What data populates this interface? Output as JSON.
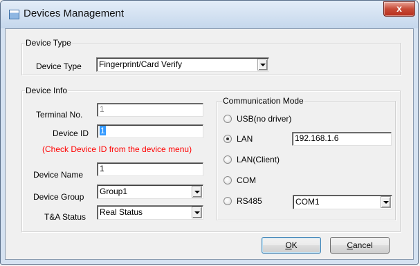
{
  "window": {
    "title": "Devices Management",
    "close_label": "x"
  },
  "device_type_group": {
    "legend": "Device Type",
    "label": "Device Type",
    "value": "Fingerprint/Card Verify"
  },
  "device_info_group": {
    "legend": "Device Info",
    "terminal_no_label": "Terminal No.",
    "terminal_no_value": "1",
    "device_id_label": "Device ID",
    "device_id_value": "1",
    "device_id_hint": "(Check Device ID from the device menu)",
    "device_name_label": "Device Name",
    "device_name_value": "1",
    "device_group_label": "Device Group",
    "device_group_value": "Group1",
    "ta_status_label": "T&A Status",
    "ta_status_value": "Real Status"
  },
  "communication": {
    "legend": "Communication Mode",
    "options": [
      {
        "label": "USB(no driver)",
        "selected": false
      },
      {
        "label": "LAN",
        "selected": true
      },
      {
        "label": "LAN(Client)",
        "selected": false
      },
      {
        "label": "COM",
        "selected": false
      },
      {
        "label": "RS485",
        "selected": false
      }
    ],
    "lan_ip": "192.168.1.6",
    "rs485_port": "COM1"
  },
  "buttons": {
    "ok_mnemonic": "O",
    "ok_rest": "K",
    "cancel_mnemonic": "C",
    "cancel_rest": "ancel"
  }
}
